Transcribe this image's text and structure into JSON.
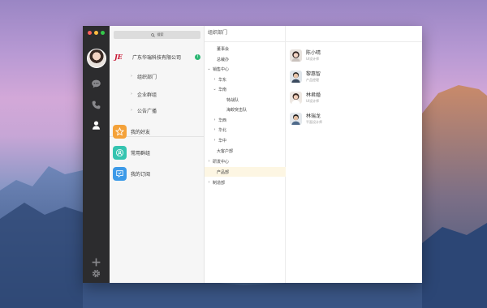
{
  "colors": {
    "rail": "#2c2c2e",
    "accent_orange": "#f4a23a",
    "accent_teal": "#35c4b0",
    "accent_blue": "#3d9ae8",
    "company_badge": "#2bb673",
    "logo_red": "#c8102e"
  },
  "search": {
    "label": "搜索",
    "icon": "search-icon"
  },
  "company": {
    "logo": "JE",
    "name": "广东华瑞科技有限公司"
  },
  "col1": {
    "sub_items": [
      {
        "label": "组织部门"
      },
      {
        "label": "企业群组"
      },
      {
        "label": "公告广播"
      }
    ],
    "quick_items": [
      {
        "label": "我的好友",
        "icon": "star-icon"
      },
      {
        "label": "常用群组",
        "icon": "group-icon"
      },
      {
        "label": "我的订阅",
        "icon": "subscribe-icon"
      }
    ]
  },
  "col2": {
    "title": "组织部门",
    "tree": [
      {
        "label": "董事会",
        "toggle": ""
      },
      {
        "label": "总裁办",
        "toggle": ""
      },
      {
        "label": "销售中心",
        "toggle": "⌄"
      },
      {
        "label": "华东",
        "toggle": "›"
      },
      {
        "label": "华南",
        "toggle": "⌄"
      },
      {
        "label": "特战队",
        "toggle": ""
      },
      {
        "label": "海蛟突击队",
        "toggle": ""
      },
      {
        "label": "华西",
        "toggle": "›"
      },
      {
        "label": "华北",
        "toggle": "›"
      },
      {
        "label": "华中",
        "toggle": "›"
      },
      {
        "label": "大客户部",
        "toggle": ""
      },
      {
        "label": "研发中心",
        "toggle": "›"
      },
      {
        "label": "产品部",
        "toggle": ""
      },
      {
        "label": "制造部",
        "toggle": "›"
      }
    ]
  },
  "members": [
    {
      "name": "陈小晴",
      "role": "UI设计师"
    },
    {
      "name": "黎惠智",
      "role": "产品经理"
    },
    {
      "name": "林君婚",
      "role": "UI设计师"
    },
    {
      "name": "林瑞龙",
      "role": "平面设计师"
    }
  ]
}
